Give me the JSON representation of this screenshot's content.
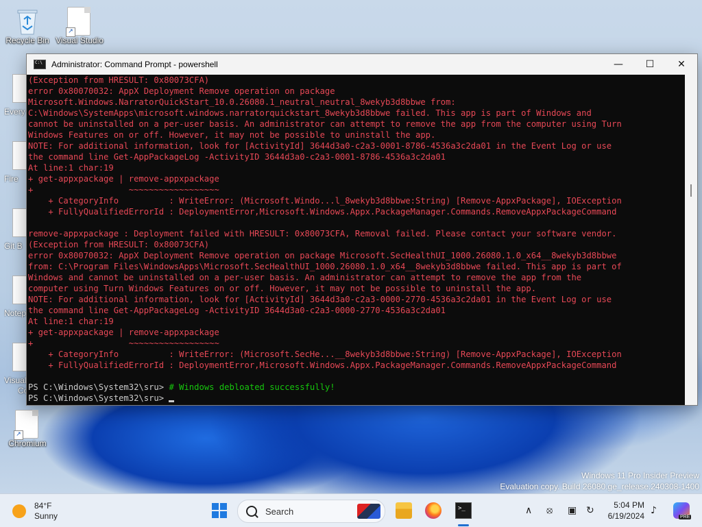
{
  "desktop": {
    "icons": [
      {
        "label": "Recycle Bin"
      },
      {
        "label": "Visual Studio"
      }
    ],
    "partial_labels": [
      "Every",
      "Fire",
      "Git B",
      "Notep",
      "Visual",
      "Co"
    ],
    "chromium_label": "Chromium"
  },
  "window": {
    "title": "Administrator: Command Prompt - powershell",
    "minimize_glyph": "—",
    "maximize_glyph": "☐",
    "close_glyph": "✕"
  },
  "console": {
    "lines": [
      {
        "text": "(Exception from HRESULT: 0x80073CFA)",
        "style": "err"
      },
      {
        "text": "error 0x80070032: AppX Deployment Remove operation on package",
        "style": "err"
      },
      {
        "text": "Microsoft.Windows.NarratorQuickStart_10.0.26080.1_neutral_neutral_8wekyb3d8bbwe from:",
        "style": "err"
      },
      {
        "text": "C:\\Windows\\SystemApps\\microsoft.windows.narratorquickstart_8wekyb3d8bbwe failed. This app is part of Windows and",
        "style": "err"
      },
      {
        "text": "cannot be uninstalled on a per-user basis. An administrator can attempt to remove the app from the computer using Turn",
        "style": "err"
      },
      {
        "text": "Windows Features on or off. However, it may not be possible to uninstall the app.",
        "style": "err"
      },
      {
        "text": "NOTE: For additional information, look for [ActivityId] 3644d3a0-c2a3-0001-8786-4536a3c2da01 in the Event Log or use",
        "style": "err"
      },
      {
        "text": "the command line Get-AppPackageLog -ActivityID 3644d3a0-c2a3-0001-8786-4536a3c2da01",
        "style": "err"
      },
      {
        "text": "At line:1 char:19",
        "style": "err"
      },
      {
        "text": "+ get-appxpackage | remove-appxpackage",
        "style": "err"
      },
      {
        "text": "+                   ~~~~~~~~~~~~~~~~~~",
        "style": "err"
      },
      {
        "text": "    + CategoryInfo          : WriteError: (Microsoft.Windo...l_8wekyb3d8bbwe:String) [Remove-AppxPackage], IOException",
        "style": "err"
      },
      {
        "text": "    + FullyQualifiedErrorId : DeploymentError,Microsoft.Windows.Appx.PackageManager.Commands.RemoveAppxPackageCommand",
        "style": "err"
      },
      {
        "text": "",
        "style": "err"
      },
      {
        "text": "remove-appxpackage : Deployment failed with HRESULT: 0x80073CFA, Removal failed. Please contact your software vendor.",
        "style": "err"
      },
      {
        "text": "(Exception from HRESULT: 0x80073CFA)",
        "style": "err"
      },
      {
        "text": "error 0x80070032: AppX Deployment Remove operation on package Microsoft.SecHealthUI_1000.26080.1.0_x64__8wekyb3d8bbwe",
        "style": "err"
      },
      {
        "text": "from: C:\\Program Files\\WindowsApps\\Microsoft.SecHealthUI_1000.26080.1.0_x64__8wekyb3d8bbwe failed. This app is part of",
        "style": "err"
      },
      {
        "text": "Windows and cannot be uninstalled on a per-user basis. An administrator can attempt to remove the app from the",
        "style": "err"
      },
      {
        "text": "computer using Turn Windows Features on or off. However, it may not be possible to uninstall the app.",
        "style": "err"
      },
      {
        "text": "NOTE: For additional information, look for [ActivityId] 3644d3a0-c2a3-0000-2770-4536a3c2da01 in the Event Log or use",
        "style": "err"
      },
      {
        "text": "the command line Get-AppPackageLog -ActivityID 3644d3a0-c2a3-0000-2770-4536a3c2da01",
        "style": "err"
      },
      {
        "text": "At line:1 char:19",
        "style": "err"
      },
      {
        "text": "+ get-appxpackage | remove-appxpackage",
        "style": "err"
      },
      {
        "text": "+                   ~~~~~~~~~~~~~~~~~~",
        "style": "err"
      },
      {
        "text": "    + CategoryInfo          : WriteError: (Microsoft.SecHe...__8wekyb3d8bbwe:String) [Remove-AppxPackage], IOException",
        "style": "err"
      },
      {
        "text": "    + FullyQualifiedErrorId : DeploymentError,Microsoft.Windows.Appx.PackageManager.Commands.RemoveAppxPackageCommand",
        "style": "err"
      },
      {
        "text": "",
        "style": "err"
      }
    ],
    "prompt1": "PS C:\\Windows\\System32\\sru> ",
    "comment": "# Windows debloated successfully!",
    "prompt2": "PS C:\\Windows\\System32\\sru> "
  },
  "watermark": {
    "line1": "Windows 11 Pro Insider Preview",
    "line2": "Evaluation copy. Build 26080.ge_release.240308-1400"
  },
  "taskbar": {
    "weather_temp": "84°F",
    "weather_desc": "Sunny",
    "search_placeholder": "Search",
    "time": "5:04 PM",
    "date": "6/19/2024",
    "copilot_badge": "PRE",
    "tray": {
      "chevron": "∧",
      "network": "⦻",
      "display": "▣",
      "sync": "↻",
      "bell": "♪"
    }
  },
  "colors": {
    "error_text": "#e74856",
    "normal_text": "#cccccc",
    "comment_text": "#16c60c",
    "console_bg": "#0c0c0c"
  }
}
